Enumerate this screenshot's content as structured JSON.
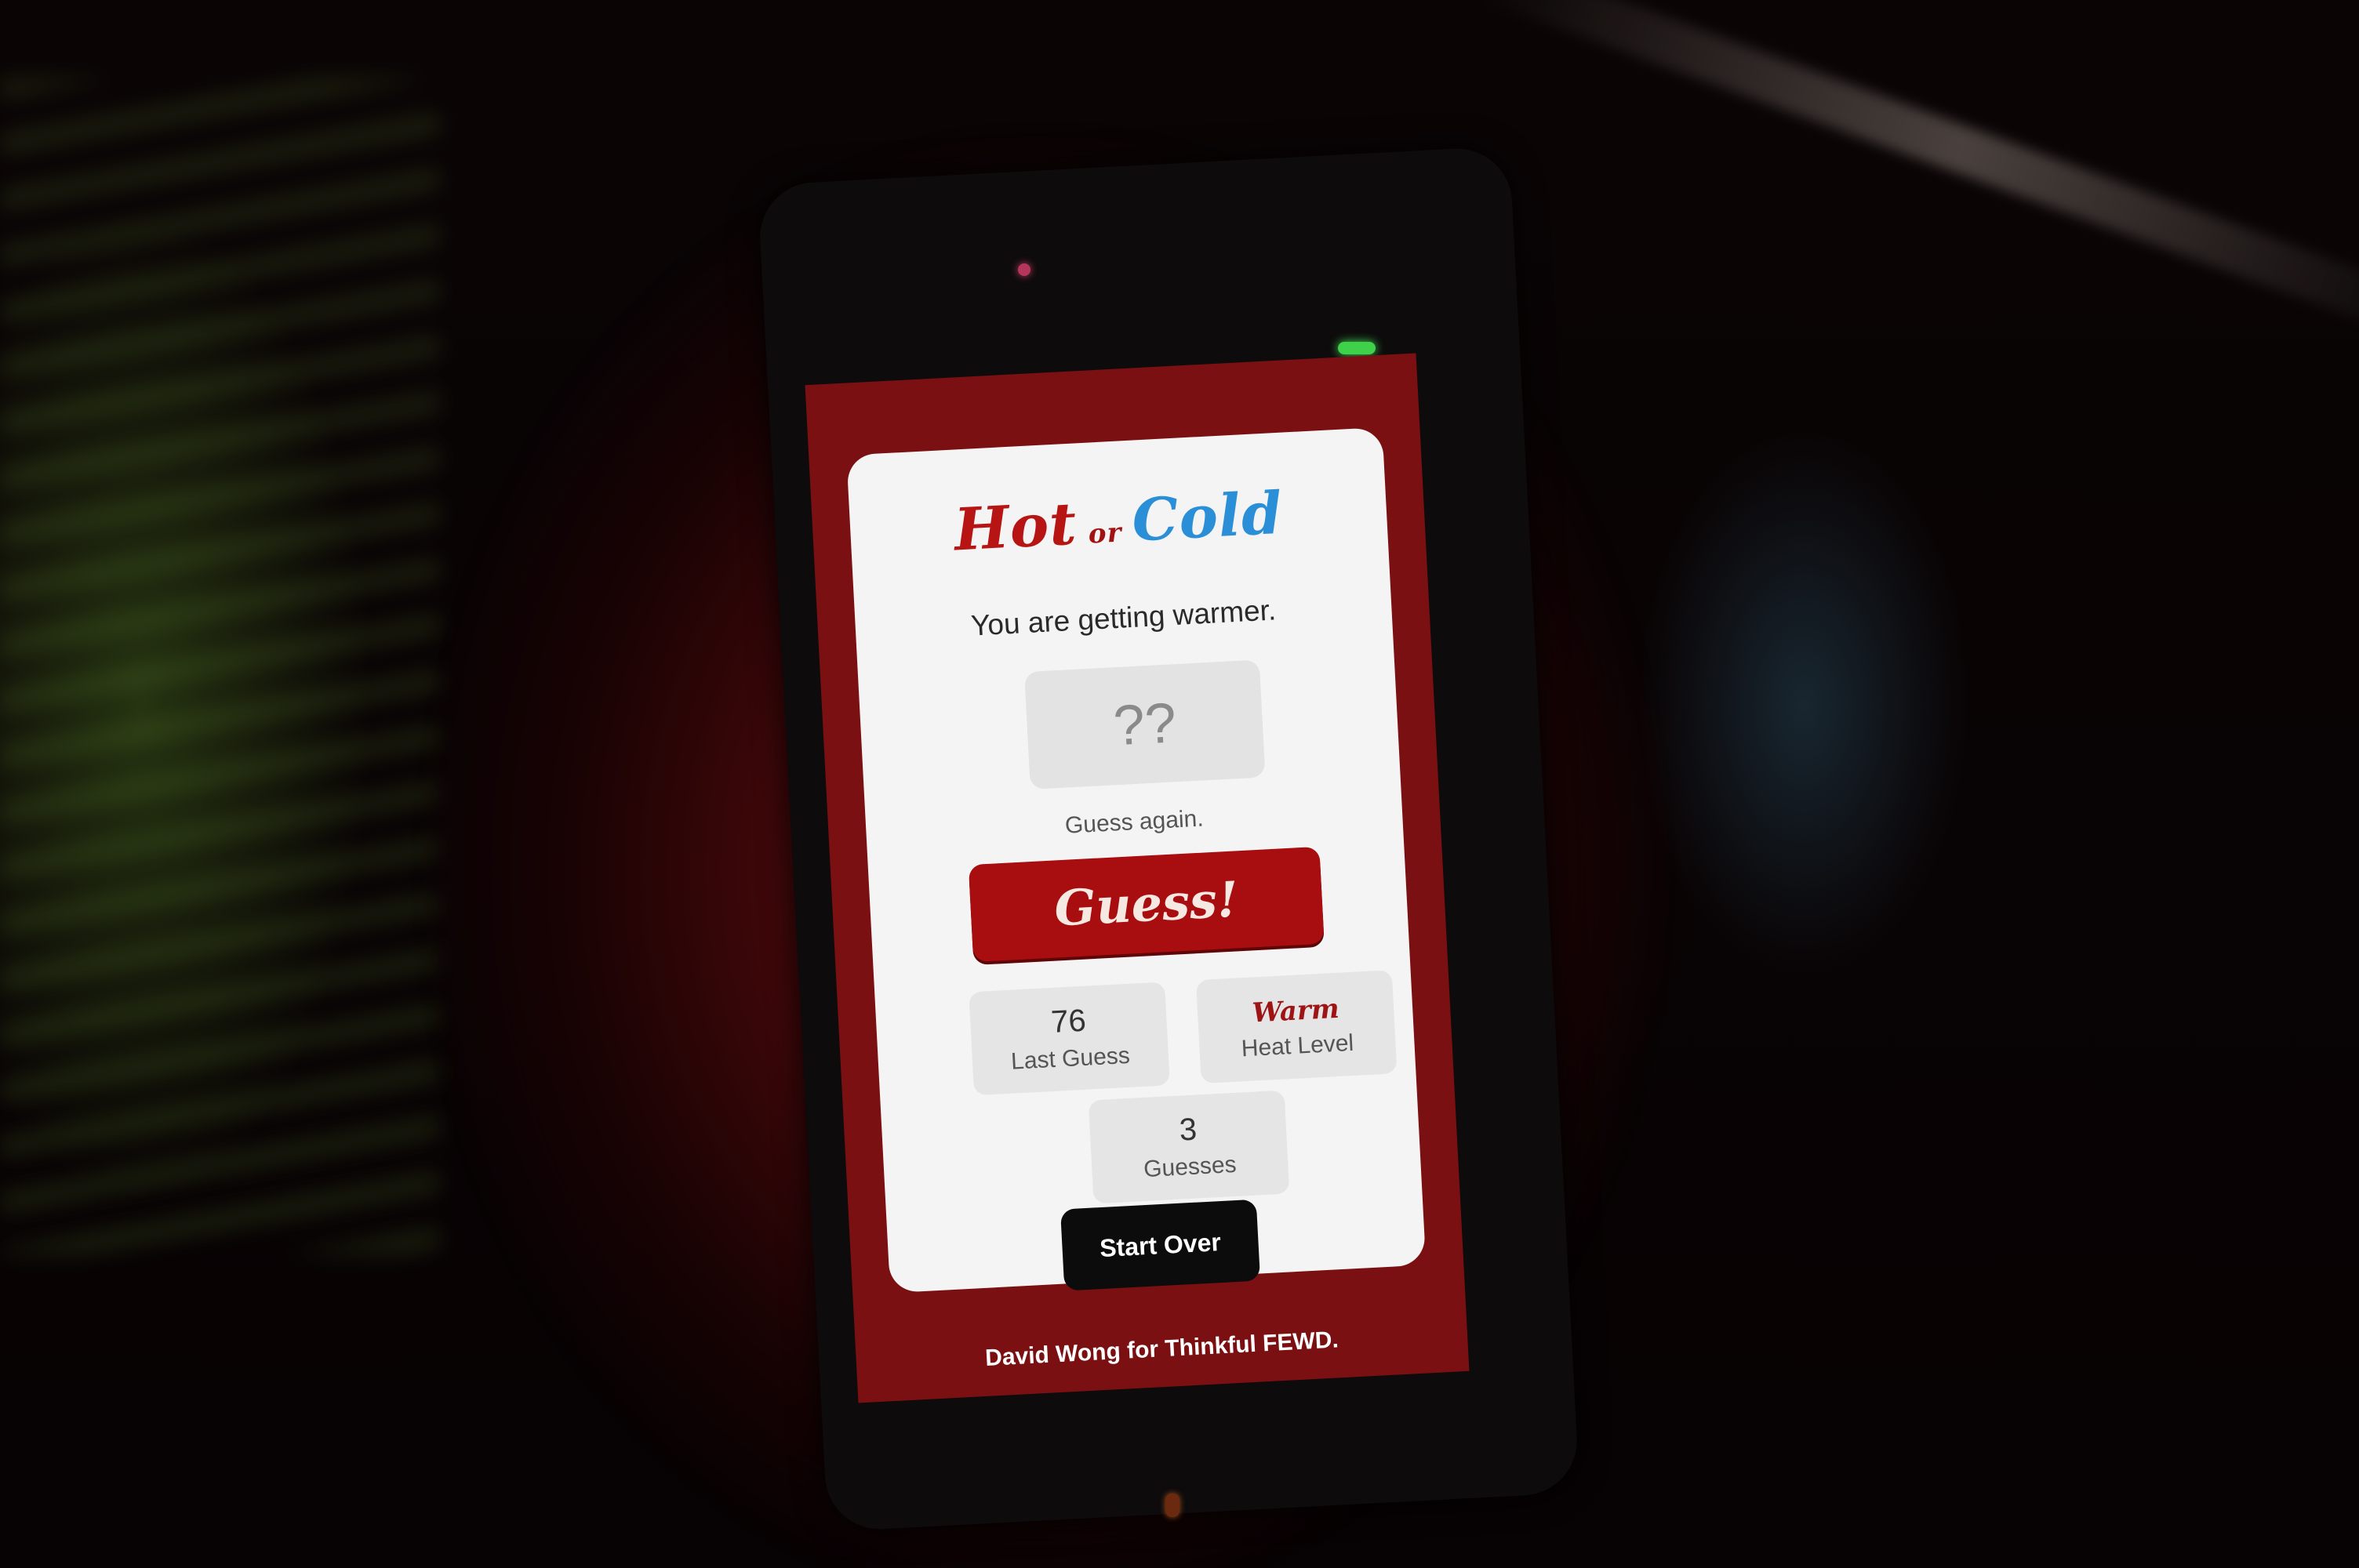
{
  "app": {
    "logo": {
      "hot": "Hot",
      "or": "or",
      "cold": "Cold"
    },
    "feedback_text": "You are getting warmer.",
    "guess_input": {
      "placeholder": "??",
      "value": ""
    },
    "hint_text": "Guess again.",
    "guess_button_label": "Guess!",
    "stats": {
      "last_guess": {
        "value": "76",
        "label": "Last Guess"
      },
      "heat_level": {
        "value": "Warm",
        "label": "Heat Level"
      },
      "guesses": {
        "value": "3",
        "label": "Guesses"
      }
    },
    "start_over_label": "Start Over",
    "footer_credit": "David Wong for Thinkful FEWD."
  },
  "colors": {
    "screen_background": "#7b1012",
    "card_background": "#f4f4f4",
    "hot_red": "#b71414",
    "cold_blue": "#2a8fd6",
    "guess_button": "#a80d10",
    "start_over_button": "#0c0c0c",
    "stat_box": "#e5e5e5"
  }
}
